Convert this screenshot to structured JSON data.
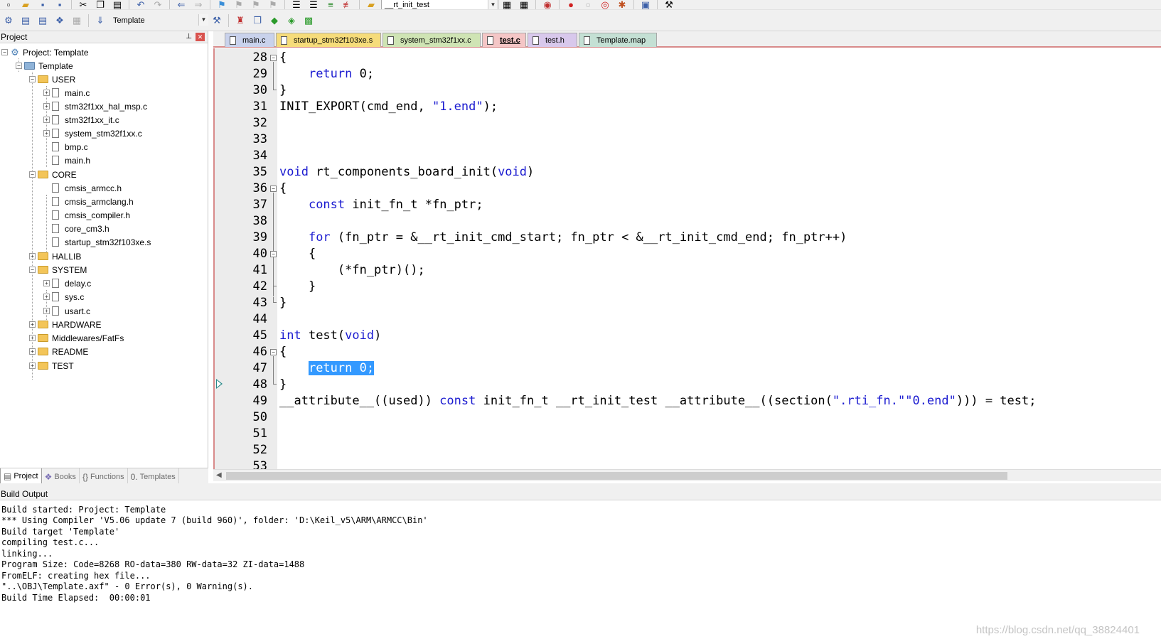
{
  "toolbar": {
    "function_combo": "__rt_init_test",
    "target_combo": "Template"
  },
  "project_panel": {
    "title": "Project",
    "root": "Project: Template",
    "target": "Template",
    "groups": {
      "user": {
        "label": "USER",
        "files": [
          "main.c",
          "stm32f1xx_hal_msp.c",
          "stm32f1xx_it.c",
          "system_stm32f1xx.c",
          "bmp.c",
          "main.h"
        ]
      },
      "core": {
        "label": "CORE",
        "files": [
          "cmsis_armcc.h",
          "cmsis_armclang.h",
          "cmsis_compiler.h",
          "core_cm3.h",
          "startup_stm32f103xe.s"
        ]
      },
      "hallib": {
        "label": "HALLIB"
      },
      "system": {
        "label": "SYSTEM",
        "files": [
          "delay.c",
          "sys.c",
          "usart.c"
        ]
      },
      "hardware": {
        "label": "HARDWARE"
      },
      "fatfs": {
        "label": "Middlewares/FatFs"
      },
      "readme": {
        "label": "README"
      },
      "test": {
        "label": "TEST"
      }
    },
    "tabs": [
      "Project",
      "Books",
      "Functions",
      "Templates"
    ]
  },
  "editor": {
    "tabs": [
      "main.c",
      "startup_stm32f103xe.s",
      "system_stm32f1xx.c",
      "test.c",
      "test.h",
      "Template.map"
    ],
    "active_tab": "test.c",
    "line_numbers": [
      "28",
      "29",
      "30",
      "31",
      "32",
      "33",
      "34",
      "35",
      "36",
      "37",
      "38",
      "39",
      "40",
      "41",
      "42",
      "43",
      "44",
      "45",
      "46",
      "47",
      "48",
      "49",
      "50",
      "51",
      "52",
      "53"
    ],
    "code": {
      "l31_a": "INIT_EXPORT(cmd_end, ",
      "l31_b": "\"1.end\"",
      "l31_c": ");",
      "l35_a": "void",
      "l35_b": " rt_components_board_init(",
      "l35_c": "void",
      "l35_d": ")",
      "l37_a": "    ",
      "l37_b": "const",
      "l37_c": " init_fn_t *fn_ptr;",
      "l39_a": "    ",
      "l39_b": "for",
      "l39_c": " (fn_ptr = &__rt_init_cmd_start; fn_ptr < &__rt_init_cmd_end; fn_ptr++)",
      "l40": "    {",
      "l41": "        (*fn_ptr)();",
      "l42": "    }",
      "l45_a": "int",
      "l45_b": " test(",
      "l45_c": "void",
      "l45_d": ")",
      "return_kw": "return",
      "return_val": " 0;",
      "open_brace": "{",
      "close_brace": "}",
      "l49_a": "__attribute__((used)) ",
      "l49_b": "const",
      "l49_c": " init_fn_t __rt_init_test __attribute__((section(",
      "l49_d": "\".rti_fn.\"\"0.end\"",
      "l49_e": "))) = test;"
    }
  },
  "build_output": {
    "title": "Build Output",
    "lines": [
      "Build started: Project: Template",
      "*** Using Compiler 'V5.06 update 7 (build 960)', folder: 'D:\\Keil_v5\\ARM\\ARMCC\\Bin'",
      "Build target 'Template'",
      "compiling test.c...",
      "linking...",
      "Program Size: Code=8268 RO-data=380 RW-data=32 ZI-data=1488",
      "FromELF: creating hex file...",
      "\"..\\OBJ\\Template.axf\" - 0 Error(s), 0 Warning(s).",
      "Build Time Elapsed:  00:00:01"
    ],
    "watermark": "https://blog.csdn.net/qq_38824401"
  }
}
